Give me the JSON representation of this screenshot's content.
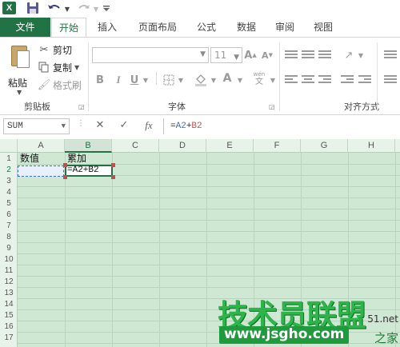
{
  "app": {
    "logo": "X"
  },
  "tabs": [
    {
      "label": "文件"
    },
    {
      "label": "开始"
    },
    {
      "label": "插入"
    },
    {
      "label": "页面布局"
    },
    {
      "label": "公式"
    },
    {
      "label": "数据"
    },
    {
      "label": "审阅"
    },
    {
      "label": "视图"
    }
  ],
  "ribbon": {
    "clipboard": {
      "paste": "粘贴",
      "cut": "剪切",
      "copy": "复制",
      "format_painter": "格式刷",
      "group_label": "剪贴板"
    },
    "font": {
      "font_name": "",
      "font_size": "11",
      "group_label": "字体",
      "bold": "B",
      "italic": "I",
      "underline": "U",
      "grow": "A",
      "shrink": "A",
      "color": "A",
      "phonetic": "文"
    },
    "alignment": {
      "group_label": "对齐方式"
    }
  },
  "formula_bar": {
    "name_box": "SUM",
    "cancel": "✕",
    "enter": "✓",
    "fx": "fx",
    "formula_eq": "=",
    "formula_ref1": "A2",
    "formula_plus": "+",
    "formula_ref2": "B2"
  },
  "sheet": {
    "columns": [
      "A",
      "B",
      "C",
      "D",
      "E",
      "F",
      "G",
      "H"
    ],
    "rows": [
      "1",
      "2",
      "3",
      "4",
      "5",
      "6",
      "7",
      "8",
      "9",
      "10",
      "11",
      "12",
      "13",
      "14",
      "15",
      "16",
      "17"
    ],
    "cells": {
      "A1": "数值",
      "B1": "累加",
      "B2": "=A2+B2"
    },
    "selected_column": "B",
    "active_cell": "B2"
  },
  "watermark": {
    "title": "技术员联盟",
    "url": "www.jsgho.com",
    "side_net": "51.net",
    "side_text": "之家"
  }
}
